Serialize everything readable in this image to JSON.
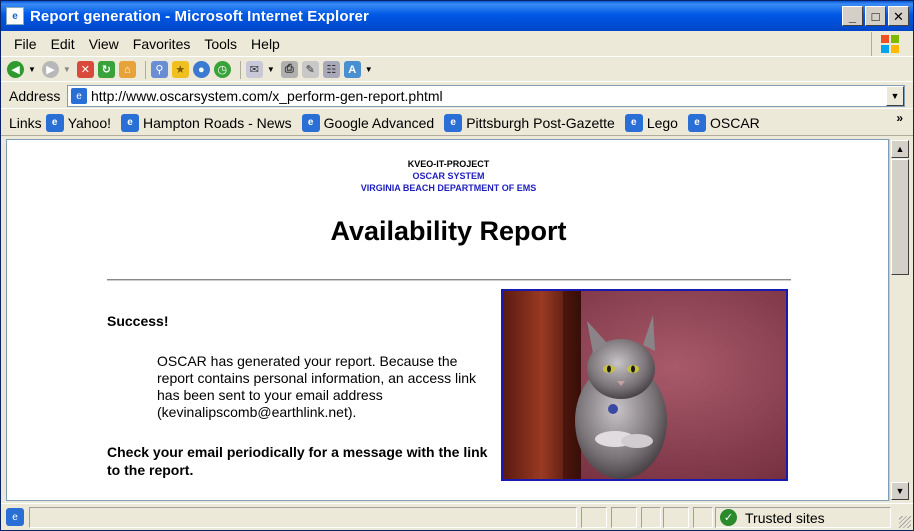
{
  "window": {
    "title": "Report generation - Microsoft Internet Explorer"
  },
  "menu": [
    "File",
    "Edit",
    "View",
    "Favorites",
    "Tools",
    "Help"
  ],
  "address": {
    "label": "Address",
    "url": "http://www.oscarsystem.com/x_perform-gen-report.phtml"
  },
  "links": {
    "label": "Links",
    "items": [
      "Yahoo!",
      "Hampton Roads - News",
      "Google Advanced",
      "Pittsburgh Post-Gazette",
      "Lego",
      "OSCAR"
    ]
  },
  "page": {
    "header_line1": "KVEO-IT-PROJECT",
    "header_line2": "OSCAR SYSTEM",
    "header_line3": "VIRGINIA BEACH DEPARTMENT OF EMS",
    "title": "Availability Report",
    "success": "Success!",
    "body": "OSCAR has generated your report.  Because the report contains personal information, an access link has been sent to your email address (kevinalipscomb@earthlink.net).",
    "check": "Check your email periodically for a message with the link to the report."
  },
  "status": {
    "zone": "Trusted sites"
  },
  "colors": {
    "title_bar": "#0058e6",
    "link_blue": "#2020c0",
    "photo_border": "#1a1ab0"
  }
}
